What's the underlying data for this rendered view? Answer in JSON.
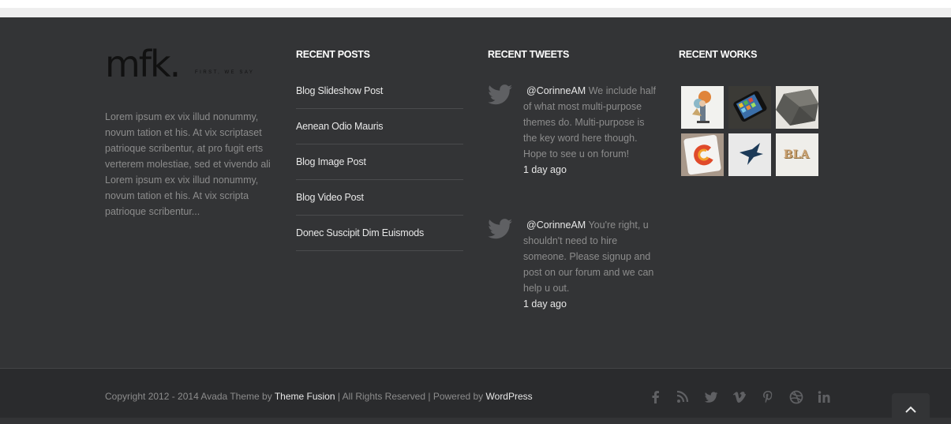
{
  "logo": {
    "wordmark": "mfk.",
    "tagline": "FIRST, WE SAY"
  },
  "about": {
    "text": "Lorem ipsum ex vix illud nonummy, novum tation et his. At vix scriptaset patrioque scribentur, at pro fugit erts verterem molestiae, sed et vivendo ali Lorem ipsum ex vix illud nonummy, novum tation et his. At vix scripta patrioque scribentur..."
  },
  "recent_posts": {
    "title": "RECENT POSTS",
    "items": [
      "Blog Slideshow Post",
      "Aenean Odio Mauris",
      "Blog Image Post",
      "Blog Video Post",
      "Donec Suscipit Dim Euismods"
    ]
  },
  "recent_tweets": {
    "title": "RECENT TWEETS",
    "items": [
      {
        "user": "@CorinneAM",
        "text": "We include half of what most multi-purpose themes do. Multi-purpose is the key word here though. Hope to see u on forum!",
        "time": "1 day ago"
      },
      {
        "user": "@CorinneAM",
        "text": "You're right, u shouldn't need to hire someone. Please signup and post on our forum and we can help u out.",
        "time": "1 day ago"
      }
    ]
  },
  "recent_works": {
    "title": "RECENT WORKS",
    "thumbnails": [
      {
        "name": "illustration-thumb"
      },
      {
        "name": "phone-thumb"
      },
      {
        "name": "stone-thumb"
      },
      {
        "name": "logo-c-thumb"
      },
      {
        "name": "bird-tshirt-thumb"
      },
      {
        "name": "bla-text-thumb"
      }
    ]
  },
  "copyright": {
    "prefix": "Copyright 2012 - 2014 Avada Theme by ",
    "theme_link": "Theme Fusion",
    "middle": " | All Rights Reserved | Powered by ",
    "wp_link": "WordPress"
  },
  "social_icons": [
    "facebook-icon",
    "rss-icon",
    "twitter-icon",
    "vimeo-icon",
    "pinterest-icon",
    "dribbble-icon",
    "linkedin-icon"
  ],
  "colors": {
    "footer_bg": "#333436",
    "copyright_bg": "#2a2b2d",
    "text_muted": "#8c8c8c",
    "text_light": "#e8e8e8",
    "icon": "#5f6063"
  }
}
